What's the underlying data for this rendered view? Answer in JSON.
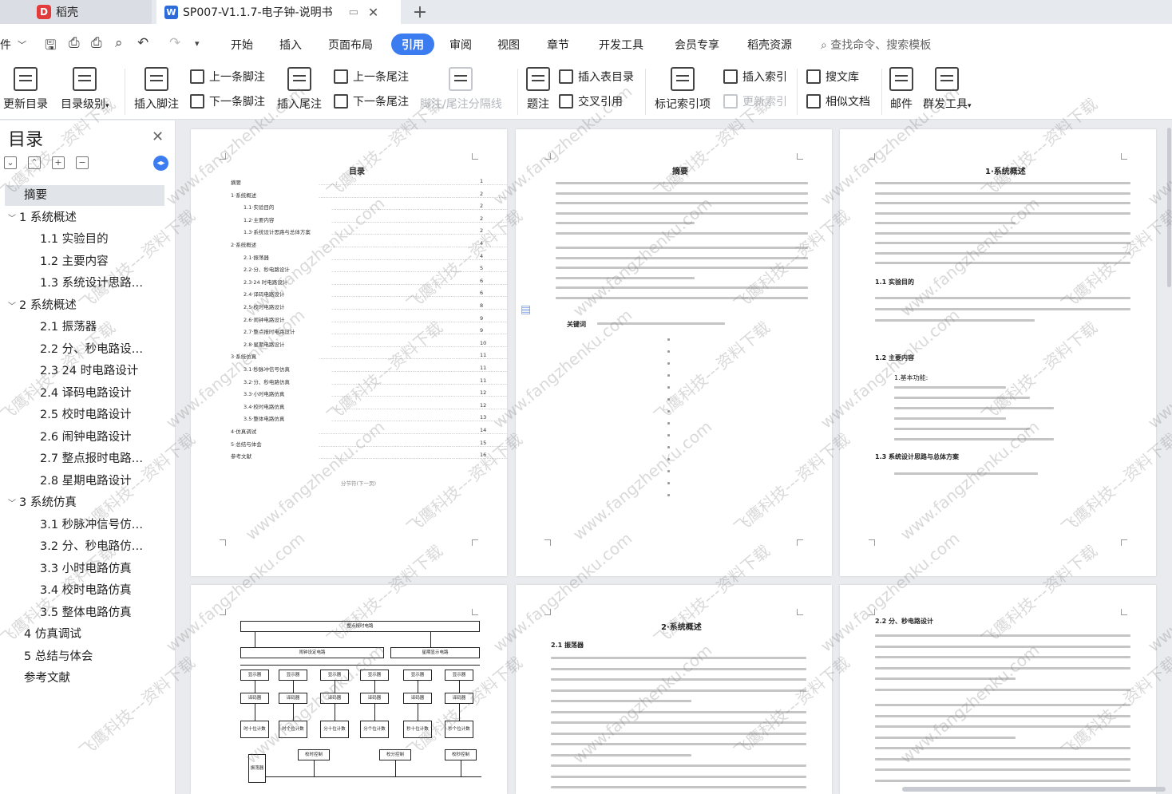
{
  "tabs": {
    "home": "稻壳",
    "doc": "SP007-V1.1.7-电子钟-说明书",
    "add": "+"
  },
  "menu": {
    "file": "件",
    "items": [
      "开始",
      "插入",
      "页面布局",
      "引用",
      "审阅",
      "视图",
      "章节",
      "开发工具",
      "会员专享",
      "稻壳资源"
    ],
    "active": "引用",
    "search": "查找命令、搜索模板"
  },
  "ribbon": {
    "update_toc": "更新目录",
    "toc_level": "目录级别",
    "insert_footnote": "插入脚注",
    "prev_footnote": "上一条脚注",
    "next_footnote": "下一条脚注",
    "insert_endnote": "插入尾注",
    "prev_endnote": "上一条尾注",
    "next_endnote": "下一条尾注",
    "separator": "脚注/尾注分隔线",
    "caption": "题注",
    "insert_table_toc": "插入表目录",
    "cross_ref": "交叉引用",
    "mark_index": "标记索引项",
    "insert_index": "插入索引",
    "update_index": "更新索引",
    "search_lib": "搜文库",
    "similar_doc": "相似文档",
    "mail": "邮件",
    "mass_tool": "群发工具"
  },
  "sidebar": {
    "title": "目录",
    "items": [
      {
        "label": "摘要",
        "level": 1,
        "selected": true
      },
      {
        "label": "1  系统概述",
        "level": 0
      },
      {
        "label": "1.1 实验目的",
        "level": 2
      },
      {
        "label": "1.2  主要内容",
        "level": 2
      },
      {
        "label": "1.3  系统设计思路…",
        "level": 2
      },
      {
        "label": "2  系统概述",
        "level": 0
      },
      {
        "label": "2.1 振荡器",
        "level": 2
      },
      {
        "label": "2.2  分、秒电路设…",
        "level": 2
      },
      {
        "label": "2.3 24 时电路设计",
        "level": 2
      },
      {
        "label": "2.4  译码电路设计",
        "level": 2
      },
      {
        "label": "2.5  校时电路设计",
        "level": 2
      },
      {
        "label": "2.6  闹钟电路设计",
        "level": 2
      },
      {
        "label": "2.7  整点报时电路…",
        "level": 2
      },
      {
        "label": "2.8  星期电路设计",
        "level": 2
      },
      {
        "label": "3  系统仿真",
        "level": 0
      },
      {
        "label": "3.1  秒脉冲信号仿…",
        "level": 2
      },
      {
        "label": "3.2  分、秒电路仿…",
        "level": 2
      },
      {
        "label": "3.3  小时电路仿真",
        "level": 2
      },
      {
        "label": "3.4  校时电路仿真",
        "level": 2
      },
      {
        "label": "3.5  整体电路仿真",
        "level": 2
      },
      {
        "label": "4  仿真调试",
        "level": 1
      },
      {
        "label": "5  总结与体会",
        "level": 1
      },
      {
        "label": "参考文献",
        "level": 1
      }
    ]
  },
  "pages": {
    "toc_title": "目录",
    "toc_lines": [
      {
        "t": "摘要",
        "p": "1"
      },
      {
        "t": "1·系统概述",
        "p": "2"
      },
      {
        "t": "1.1·实验目的",
        "p": "2"
      },
      {
        "t": "1.2·主要内容",
        "p": "2"
      },
      {
        "t": "1.3·系统设计思路与总体方案",
        "p": "2"
      },
      {
        "t": "2·系统概述",
        "p": "4"
      },
      {
        "t": "2.1·振荡器",
        "p": "4"
      },
      {
        "t": "2.2·分、秒电路设计",
        "p": "5"
      },
      {
        "t": "2.3·24 时电路设计",
        "p": "6"
      },
      {
        "t": "2.4·译码电路设计",
        "p": "6"
      },
      {
        "t": "2.5·校时电路设计",
        "p": "8"
      },
      {
        "t": "2.6·闹钟电路设计",
        "p": "9"
      },
      {
        "t": "2.7·整点报时电路设计",
        "p": "9"
      },
      {
        "t": "2.8·星期电路设计",
        "p": "10"
      },
      {
        "t": "3·系统仿真",
        "p": "11"
      },
      {
        "t": "3.1·秒脉冲信号仿真",
        "p": "11"
      },
      {
        "t": "3.2·分、秒电路仿真",
        "p": "11"
      },
      {
        "t": "3.3·小时电路仿真",
        "p": "12"
      },
      {
        "t": "3.4·校时电路仿真",
        "p": "12"
      },
      {
        "t": "3.5·整体电路仿真",
        "p": "13"
      },
      {
        "t": "4·仿真调试",
        "p": "14"
      },
      {
        "t": "5·总结与体会",
        "p": "15"
      },
      {
        "t": "参考文献",
        "p": "16"
      }
    ],
    "section_break": "分节符(下一页)",
    "abstract_title": "摘要",
    "abstract_keywords": "关键词",
    "p3_title": "1·系统概述",
    "p3_h1": "1.1 实验目的",
    "p3_h2": "1.2 主要内容",
    "p3_h3": "1.3 系统设计思路与总体方案",
    "p3_func": "1.基本功能:",
    "p5_title": "2·系统概述",
    "p5_h1": "2.1 振荡器",
    "p6_h1": "2.2 分、秒电路设计",
    "diagram": {
      "top": "整点报时电路",
      "left": "闹钟设定电路",
      "right": "星期显示电路",
      "decoder": "译码器",
      "display": "显示器",
      "counters": [
        "时十位计数",
        "时个位计数",
        "分十位计数",
        "分个位计数",
        "秒十位计数",
        "秒个位计数"
      ],
      "ctrl": [
        "校时控制",
        "校分控制",
        "校秒控制"
      ],
      "osc": "振荡器"
    }
  },
  "watermark": {
    "a": "飞鹰科技---资料下载",
    "b": "www.fangzhenku.com"
  }
}
